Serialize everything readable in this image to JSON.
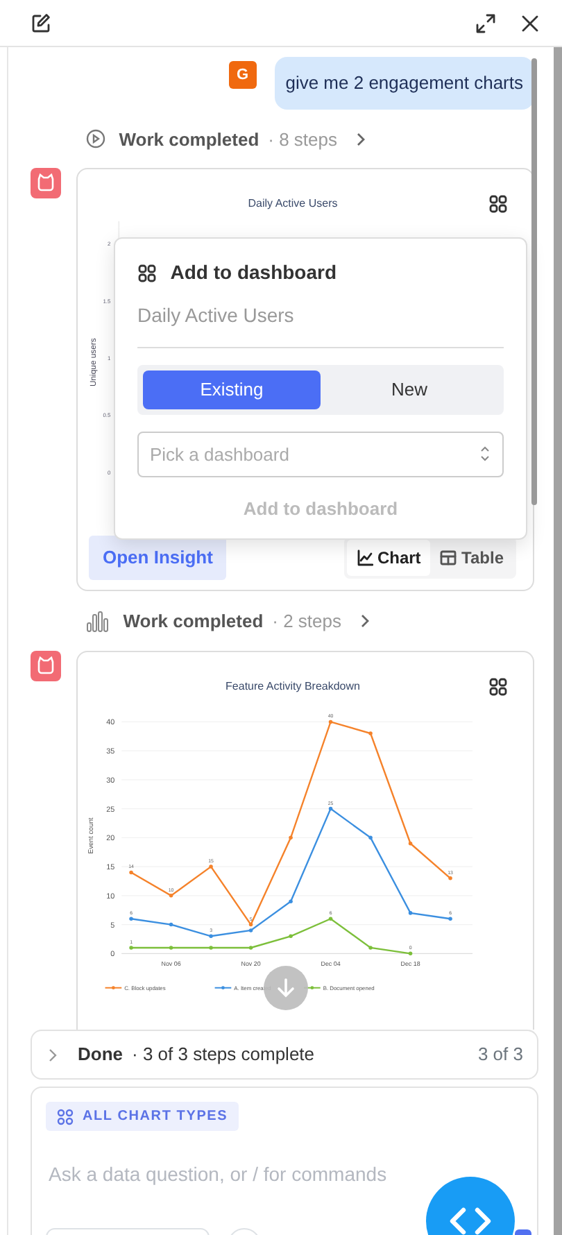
{
  "messages": [
    {
      "kind": "user",
      "avatar": "G",
      "text": "give me 2 engagement charts"
    },
    {
      "kind": "steps",
      "label": "Work completed",
      "detail": "· 8 steps"
    },
    {
      "kind": "insight",
      "chart": {
        "title": "Daily Active Users",
        "ylabel": "Unique users",
        "yticks": [
          "2",
          "1.5",
          "1",
          "0.5",
          "0"
        ]
      },
      "popover": {
        "title": "Add to dashboard",
        "insight_name": "Daily Active Users",
        "modes": [
          {
            "label": "Existing",
            "selected": true
          },
          {
            "label": "New",
            "selected": false
          }
        ],
        "select_placeholder": "Pick a dashboard",
        "submit": "Add to dashboard",
        "submit_disabled": true
      },
      "open_button": "Open Insight",
      "views": [
        {
          "label": "Chart",
          "selected": true
        },
        {
          "label": "Table",
          "selected": false
        }
      ]
    },
    {
      "kind": "steps",
      "label": "Work completed",
      "detail": "· 2 steps"
    },
    {
      "kind": "insight",
      "chart_data": {
        "type": "line",
        "title": "Feature Activity Breakdown",
        "ylabel": "Event count",
        "categories": [
          null,
          "Nov 06",
          null,
          "Nov 20",
          null,
          "Dec 04",
          null,
          "Dec 18",
          null
        ],
        "ylim": [
          0,
          40
        ],
        "grid": true,
        "legend": "bottom",
        "yticks": [
          0,
          5,
          10,
          15,
          20,
          25,
          30,
          35,
          40
        ],
        "series": [
          {
            "name": "C. Block updates",
            "color": "#f5822a",
            "values": [
              14,
              10,
              15,
              5,
              20,
              40,
              38,
              19,
              13
            ]
          },
          {
            "name": "A. Item created",
            "color": "#3b8fe0",
            "values": [
              6,
              5,
              3,
              4,
              9,
              25,
              20,
              7,
              6
            ]
          },
          {
            "name": "B. Document opened",
            "color": "#7cbf3a",
            "values": [
              1,
              1,
              1,
              1,
              3,
              6,
              1,
              0,
              null
            ]
          }
        ],
        "value_labels": [
          [
            "14",
            "10",
            "15",
            "5",
            null,
            "40",
            null,
            null,
            "13"
          ],
          [
            "6",
            null,
            "3",
            null,
            null,
            "25",
            null,
            null,
            "6"
          ],
          [
            "1",
            null,
            null,
            null,
            null,
            "6",
            null,
            "0",
            null
          ]
        ]
      }
    }
  ],
  "done": {
    "label": "Done",
    "detail": "· 3 of 3 steps complete",
    "count": "3 of 3",
    "expanded": false
  },
  "composer": {
    "chip": "ALL CHART TYPES",
    "placeholder": "Ask a data question, or / for commands"
  }
}
